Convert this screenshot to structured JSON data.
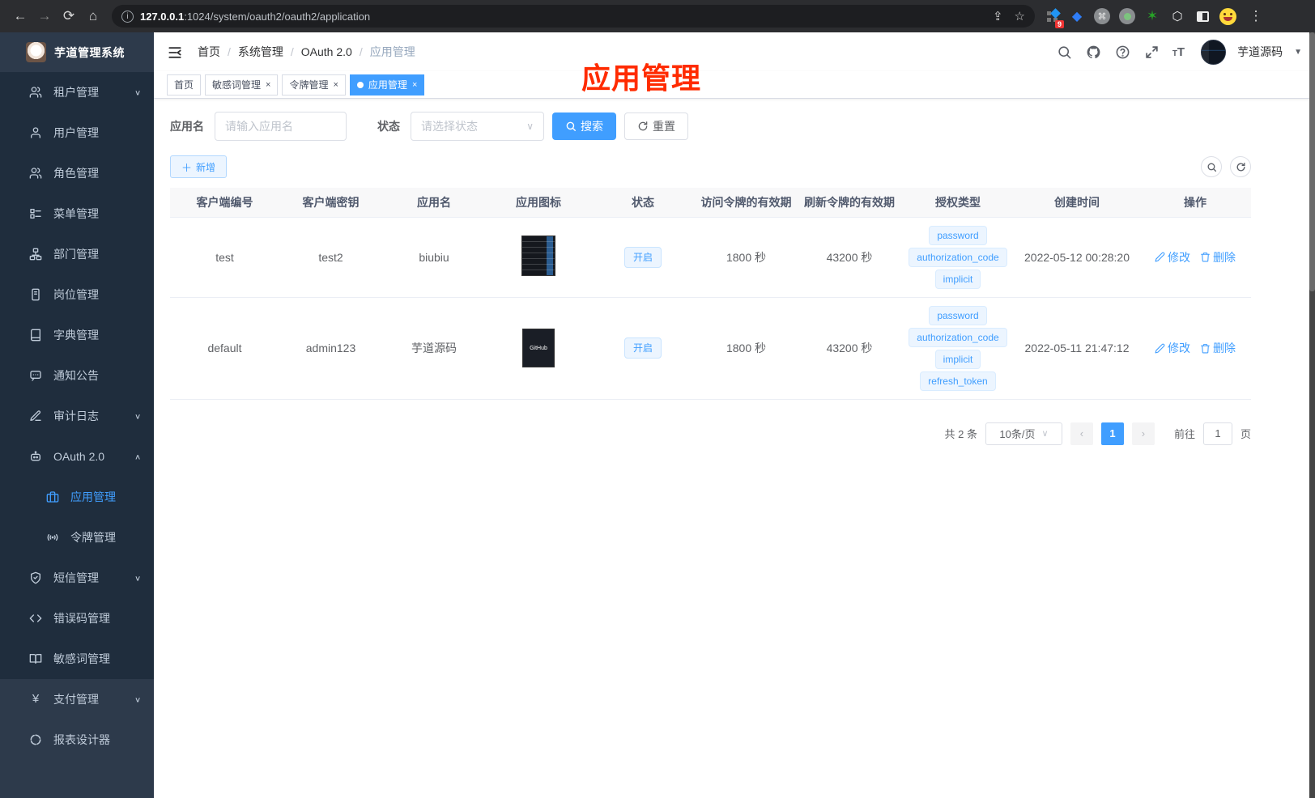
{
  "browser": {
    "url_host": "127.0.0.1",
    "url_rest": ":1024/system/oauth2/oauth2/application",
    "ext_badge": "9"
  },
  "sidebar": {
    "title": "芋道管理系统",
    "menu": [
      {
        "label": "租户管理",
        "icon": "users",
        "arrow": "down"
      },
      {
        "label": "用户管理",
        "icon": "user"
      },
      {
        "label": "角色管理",
        "icon": "users"
      },
      {
        "label": "菜单管理",
        "icon": "tree"
      },
      {
        "label": "部门管理",
        "icon": "org"
      },
      {
        "label": "岗位管理",
        "icon": "badge"
      },
      {
        "label": "字典管理",
        "icon": "dict"
      },
      {
        "label": "通知公告",
        "icon": "message"
      },
      {
        "label": "审计日志",
        "icon": "log",
        "arrow": "down"
      },
      {
        "label": "OAuth 2.0",
        "icon": "robot",
        "arrow": "up",
        "children": [
          {
            "label": "应用管理",
            "icon": "briefcase",
            "active": true
          },
          {
            "label": "令牌管理",
            "icon": "token"
          }
        ]
      },
      {
        "label": "短信管理",
        "icon": "shield",
        "arrow": "down"
      },
      {
        "label": "错误码管理",
        "icon": "code"
      },
      {
        "label": "敏感词管理",
        "icon": "book"
      }
    ],
    "bottom": [
      {
        "label": "支付管理",
        "icon": "yen",
        "arrow": "down"
      },
      {
        "label": "报表设计器",
        "icon": "chart"
      }
    ]
  },
  "navbar": {
    "breadcrumb": [
      "首页",
      "系统管理",
      "OAuth 2.0",
      "应用管理"
    ],
    "username": "芋道源码"
  },
  "tabs": [
    {
      "label": "首页",
      "closable": false,
      "active": false
    },
    {
      "label": "敏感词管理",
      "closable": true,
      "active": false
    },
    {
      "label": "令牌管理",
      "closable": true,
      "active": false
    },
    {
      "label": "应用管理",
      "closable": true,
      "active": true
    }
  ],
  "annotation": "应用管理",
  "filter": {
    "name_label": "应用名",
    "name_placeholder": "请输入应用名",
    "status_label": "状态",
    "status_placeholder": "请选择状态",
    "search_label": "搜索",
    "reset_label": "重置"
  },
  "toolbar": {
    "add_label": "新增"
  },
  "table": {
    "headers": [
      "客户端编号",
      "客户端密钥",
      "应用名",
      "应用图标",
      "状态",
      "访问令牌的有效期",
      "刷新令牌的有效期",
      "授权类型",
      "创建时间",
      "操作"
    ],
    "edit_label": "修改",
    "delete_label": "删除",
    "rows": [
      {
        "client_id": "test",
        "client_secret": "test2",
        "app_name": "biubiu",
        "icon": "dashboard-thumb",
        "icon_text": "",
        "status": "开启",
        "access_ttl": "1800 秒",
        "refresh_ttl": "43200 秒",
        "grant_types": [
          "password",
          "authorization_code",
          "implicit"
        ],
        "created_at": "2022-05-12 00:28:20"
      },
      {
        "client_id": "default",
        "client_secret": "admin123",
        "app_name": "芋道源码",
        "icon": "github-thumb",
        "icon_text": "GitHub",
        "status": "开启",
        "access_ttl": "1800 秒",
        "refresh_ttl": "43200 秒",
        "grant_types": [
          "password",
          "authorization_code",
          "implicit",
          "refresh_token"
        ],
        "created_at": "2022-05-11 21:47:12"
      }
    ]
  },
  "pagination": {
    "total_label": "共 2 条",
    "page_size": "10条/页",
    "current_page": "1",
    "goto_label": "前往",
    "goto_value": "1",
    "page_suffix": "页"
  },
  "colors": {
    "accent": "#409eff",
    "annotation": "#ff2b00",
    "sidebar_bg": "#2d3a4b",
    "submenu_bg": "#1f2d3d"
  }
}
